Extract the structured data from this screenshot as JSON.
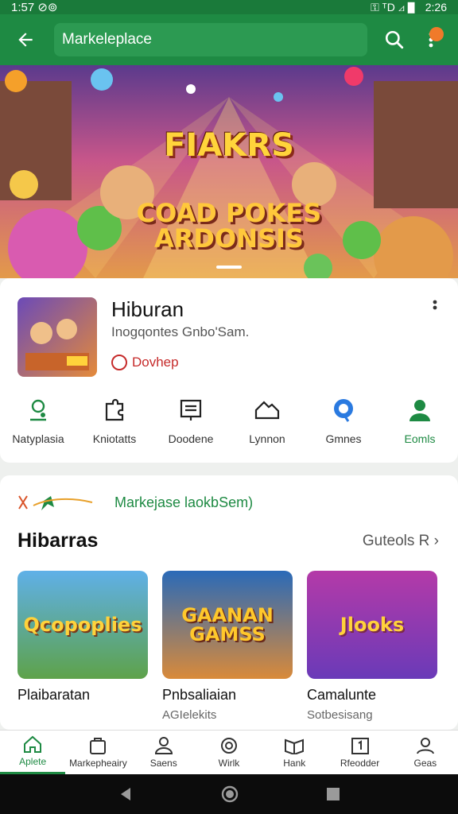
{
  "status": {
    "left": "1:57 ⊘⊚",
    "time": "2:26",
    "signal": "⚿ ᵀD ⊿ ▋"
  },
  "app_bar": {
    "title": "Markeleplace"
  },
  "colors": {
    "primary": "#1e8a43",
    "accent": "#f07a2a",
    "danger": "#c62b2b"
  },
  "hero": {
    "title": "FIAKRS",
    "subtitle_1": "COAD POKES",
    "subtitle_2": "ARDONSIS"
  },
  "app_card": {
    "name": "Hiburan",
    "desc": "Inogqontes Gnbo'Sam.",
    "badge": "Dovhep",
    "categories": [
      {
        "label": "Natyplasia",
        "icon": "person-pin-icon"
      },
      {
        "label": "Kniotatts",
        "icon": "puzzle-icon"
      },
      {
        "label": "Doodene",
        "icon": "list-board-icon"
      },
      {
        "label": "Lynnon",
        "icon": "cloud-house-icon"
      },
      {
        "label": "Gmnes",
        "icon": "game-circle-icon"
      },
      {
        "label": "Eomls",
        "icon": "user-icon"
      }
    ]
  },
  "section": {
    "promo": "Markejase laokbSem)",
    "title": "Hibarras",
    "link": "Guteols R ›",
    "games": [
      {
        "img_title": "Qcopoplies",
        "title": "Plaibaratan",
        "sub": ""
      },
      {
        "img_title": "GAANAN GAMSS",
        "title": "Pnbsaliaian",
        "sub": "AGIelekits"
      },
      {
        "img_title": "Jlooks",
        "title": "Camalunte",
        "sub": "Sotbesisang"
      }
    ]
  },
  "bottom_nav": [
    {
      "label": "Aplete",
      "icon": "home-icon"
    },
    {
      "label": "Markepheairy",
      "icon": "bag-icon"
    },
    {
      "label": "Saens",
      "icon": "person-icon"
    },
    {
      "label": "Wirlk",
      "icon": "at-icon"
    },
    {
      "label": "Hank",
      "icon": "book-icon"
    },
    {
      "label": "Rfeodder",
      "icon": "calendar-icon"
    },
    {
      "label": "Geas",
      "icon": "profile-icon"
    }
  ]
}
